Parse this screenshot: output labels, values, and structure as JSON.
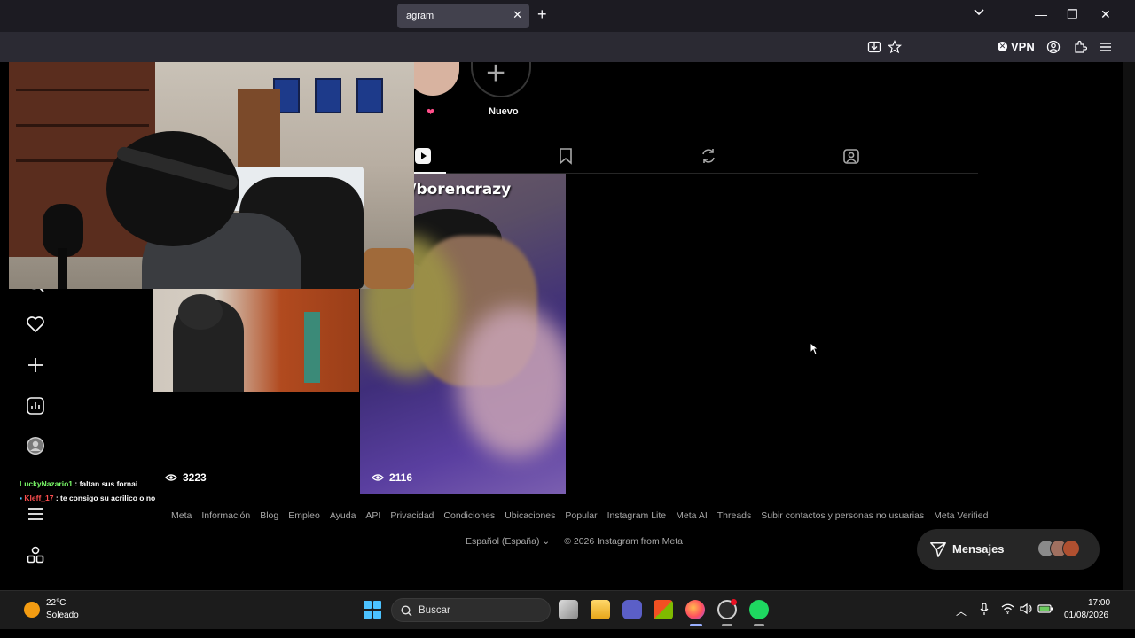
{
  "browser": {
    "tab_title": "agram",
    "tab_close": "✕",
    "new_tab": "+",
    "vpn_label": "VPN",
    "window_min": "—",
    "window_restore": "❐",
    "window_close": "✕"
  },
  "profile": {
    "highlights": [
      {
        "label": "❤"
      },
      {
        "label": "Nuevo"
      }
    ],
    "tabs": [
      "reels",
      "saved",
      "reposts",
      "tagged"
    ]
  },
  "stream_chat": [
    {
      "user": "LuckyNazario1",
      "text": ": faltan sus fornai"
    },
    {
      "user": "Kleff_17",
      "text": ": te consigo su acrilico o no"
    }
  ],
  "posts": [
    {
      "views": "3223"
    },
    {
      "views": "2116",
      "overlay_text": "k.com/borencrazy"
    }
  ],
  "footer": {
    "links": [
      "Meta",
      "Información",
      "Blog",
      "Empleo",
      "Ayuda",
      "API",
      "Privacidad",
      "Condiciones",
      "Ubicaciones",
      "Popular",
      "Instagram Lite",
      "Meta AI",
      "Threads",
      "Subir contactos y personas no usuarias",
      "Meta Verified"
    ],
    "language": "Español (España)",
    "copyright": "© 2026 Instagram from Meta"
  },
  "messages": {
    "label": "Mensajes"
  },
  "taskbar": {
    "weather_temp": "22°C",
    "weather_desc": "Soleado",
    "search_label": "Buscar",
    "time": "17:00",
    "date": "01/08/2026"
  },
  "colors": {
    "accent": "#0095f6",
    "page_bg": "#000000",
    "chrome_bg": "#1c1b22"
  }
}
